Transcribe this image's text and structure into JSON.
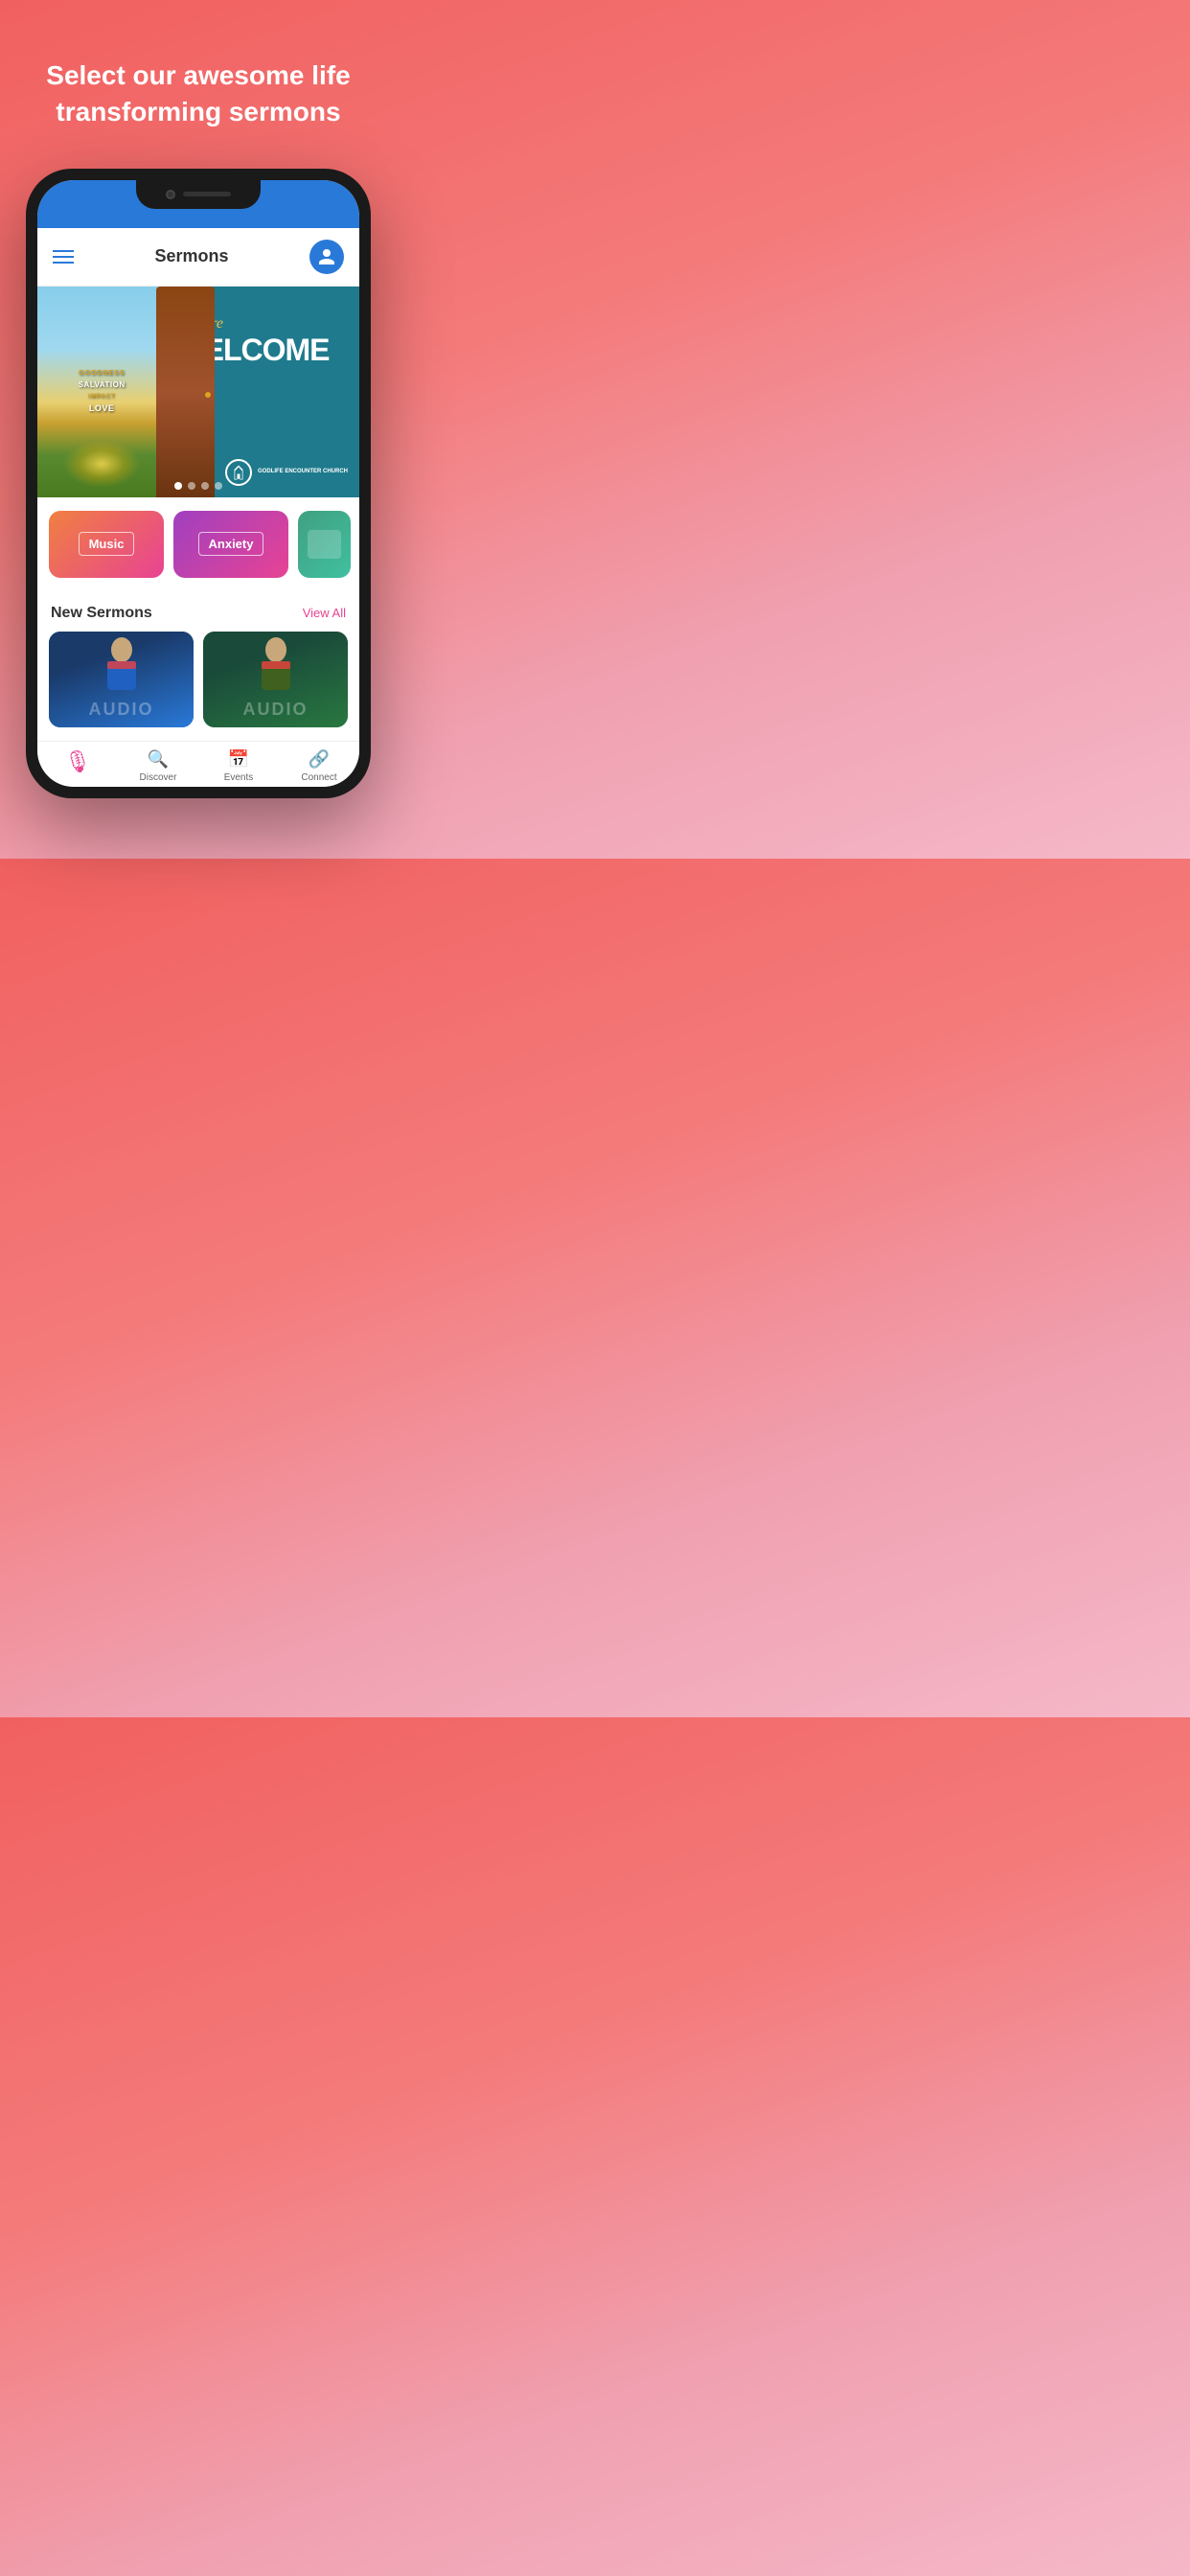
{
  "hero": {
    "title": "Select our awesome life transforming sermons"
  },
  "header": {
    "title": "Sermons"
  },
  "banner": {
    "words": [
      "GOODNESS",
      "SALVATION",
      "LOVE",
      "IMPACT"
    ],
    "welcome_italic": "You're",
    "welcome_bold": "WELCOME",
    "church_name": "GODLIFE ENCOUNTER CHURCH",
    "dots": [
      {
        "active": true
      },
      {
        "active": false
      },
      {
        "active": false
      },
      {
        "active": false
      }
    ]
  },
  "categories": [
    {
      "label": "Music",
      "type": "music"
    },
    {
      "label": "Anxiety",
      "type": "anxiety"
    },
    {
      "label": "",
      "type": "third"
    }
  ],
  "new_sermons": {
    "title": "New Sermons",
    "view_all": "View All",
    "cards": [
      {
        "label": "AUDIO"
      },
      {
        "label": "AUDIO"
      }
    ]
  },
  "bottom_nav": [
    {
      "label": "",
      "icon": "🎙",
      "active": true,
      "is_mic": true
    },
    {
      "label": "Discover",
      "active": false
    },
    {
      "label": "Events",
      "active": false
    },
    {
      "label": "Connect",
      "active": false
    }
  ]
}
